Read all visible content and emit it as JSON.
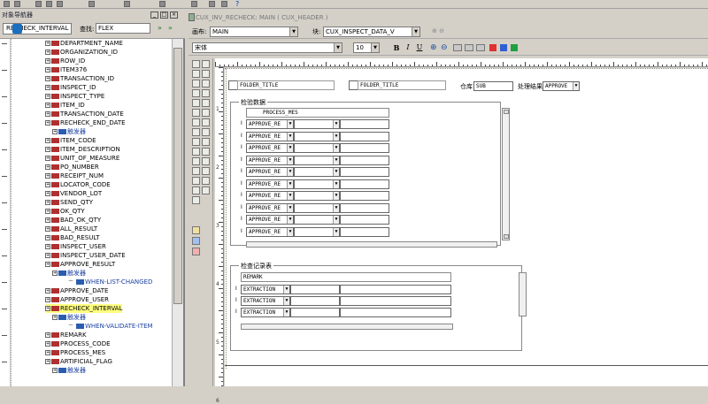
{
  "navigator": {
    "title": "对象导航器",
    "selector_value": "RECHECK_INTERVAL",
    "find_label": "查找:",
    "find_value": "FLEX",
    "tree": [
      {
        "label": "DEPARTMENT_NAME",
        "kind": "item"
      },
      {
        "label": "ORGANIZATION_ID",
        "kind": "item"
      },
      {
        "label": "ROW_ID",
        "kind": "item"
      },
      {
        "label": "ITEM376",
        "kind": "item"
      },
      {
        "label": "TRANSACTION_ID",
        "kind": "item"
      },
      {
        "label": "INSPECT_ID",
        "kind": "item"
      },
      {
        "label": "INSPECT_TYPE",
        "kind": "item"
      },
      {
        "label": "ITEM_ID",
        "kind": "item"
      },
      {
        "label": "TRANSACTION_DATE",
        "kind": "item"
      },
      {
        "label": "RECHECK_END_DATE",
        "kind": "item"
      },
      {
        "label": "触发器",
        "kind": "trigger-group"
      },
      {
        "label": "ITEM_CODE",
        "kind": "item"
      },
      {
        "label": "ITEM_DESCRIPTION",
        "kind": "item"
      },
      {
        "label": "UNIT_OF_MEASURE",
        "kind": "item"
      },
      {
        "label": "PO_NUMBER",
        "kind": "item"
      },
      {
        "label": "RECEIPT_NUM",
        "kind": "item"
      },
      {
        "label": "LOCATOR_CODE",
        "kind": "item"
      },
      {
        "label": "VENDOR_LOT",
        "kind": "item"
      },
      {
        "label": "SEND_QTY",
        "kind": "item"
      },
      {
        "label": "OK_QTY",
        "kind": "item"
      },
      {
        "label": "BAD_OK_QTY",
        "kind": "item"
      },
      {
        "label": "ALL_RESULT",
        "kind": "item"
      },
      {
        "label": "BAD_RESULT",
        "kind": "item"
      },
      {
        "label": "INSPECT_USER",
        "kind": "item"
      },
      {
        "label": "INSPECT_USER_DATE",
        "kind": "item"
      },
      {
        "label": "APPROVE_RESULT",
        "kind": "item"
      },
      {
        "label": "触发器",
        "kind": "trigger-group"
      },
      {
        "label": "WHEN-LIST-CHANGED",
        "kind": "trigger"
      },
      {
        "label": "APPROVE_DATE",
        "kind": "item"
      },
      {
        "label": "APPROVE_USER",
        "kind": "item"
      },
      {
        "label": "RECHECK_INTERVAL",
        "kind": "item",
        "highlighted": true
      },
      {
        "label": "触发器",
        "kind": "trigger-group"
      },
      {
        "label": "WHEN-VALIDATE-ITEM",
        "kind": "trigger"
      },
      {
        "label": "REMARK",
        "kind": "item"
      },
      {
        "label": "PROCESS_CODE",
        "kind": "item"
      },
      {
        "label": "PROCESS_MES",
        "kind": "item"
      },
      {
        "label": "ARTIFICIAL_FLAG",
        "kind": "item"
      },
      {
        "label": "触发器",
        "kind": "trigger-group"
      }
    ]
  },
  "editor": {
    "title": "CUX_INV_RECHECK: MAIN ( CUX_HEADER )",
    "canvas_label": "画布:",
    "canvas_value": "MAIN",
    "block_label": "块:",
    "block_value": "CUX_INSPECT_DATA_V",
    "font_value": "宋体",
    "font_size": "10",
    "bold": "B",
    "italic": "I",
    "underline": "U"
  },
  "form": {
    "header_field_1": "FOLDER_TITLE",
    "header_field_2": "FOLDER_TITLE",
    "warehouse_label": "仓库",
    "warehouse_value": "SUB",
    "result_label": "处理结果",
    "result_value": "APPROVE",
    "section1_title": "检验数据",
    "section1_header": "PROCESS_MES",
    "approve_rows": [
      "APPROVE_RE",
      "APPROVE_RE",
      "APPROVE_RE",
      "APPROVE_RE",
      "APPROVE_RE",
      "APPROVE_RE",
      "APPROVE_RE",
      "APPROVE_RE",
      "APPROVE_RE",
      "APPROVE_RE"
    ],
    "section2_title": "检查记录表",
    "section2_header": "REMARK",
    "extraction_rows": [
      "EXTRACTION",
      "EXTRACTION",
      "EXTRACTION"
    ],
    "ruler_numbers": [
      "1",
      "2",
      "3",
      "4",
      "5",
      "6"
    ]
  }
}
